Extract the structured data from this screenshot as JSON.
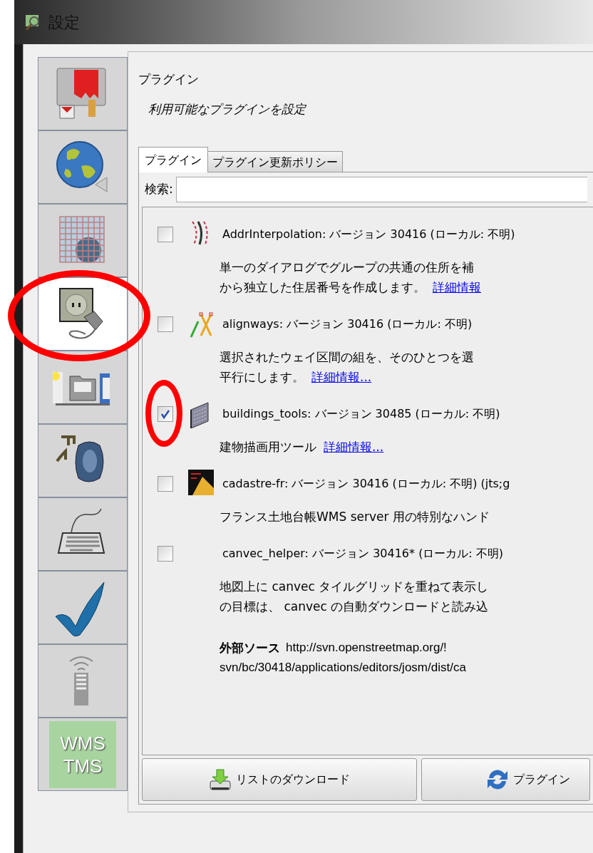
{
  "window": {
    "title": "設定"
  },
  "sidebar": {
    "items": [
      {
        "kind": "paint",
        "selected": false,
        "circled": false
      },
      {
        "kind": "globe",
        "selected": false,
        "circled": false
      },
      {
        "kind": "grid",
        "selected": false,
        "circled": false
      },
      {
        "kind": "plug",
        "selected": true,
        "circled": true
      },
      {
        "kind": "folders",
        "selected": false,
        "circled": false
      },
      {
        "kind": "speaker",
        "selected": false,
        "circled": false
      },
      {
        "kind": "keyboard",
        "selected": false,
        "circled": false
      },
      {
        "kind": "check",
        "selected": false,
        "circled": false
      },
      {
        "kind": "remote",
        "selected": false,
        "circled": false
      },
      {
        "kind": "wms",
        "selected": false,
        "circled": false,
        "label_lines": [
          "WMS",
          "TMS"
        ]
      }
    ]
  },
  "panel": {
    "title": "プラグイン",
    "subtitle": "利用可能なプラグインを設定"
  },
  "tabs": [
    {
      "label": "プラグイン",
      "selected": true
    },
    {
      "label": "プラグイン更新ポリシー",
      "selected": false
    }
  ],
  "search": {
    "label": "検索:"
  },
  "plugins": [
    {
      "kind": "addr",
      "checked": false,
      "circled": false,
      "title": "AddrInterpolation: バージョン 30416 (ローカル: 不明)",
      "description": [
        "単一のダイアログでグループの共通の住所を補",
        "から独立した住居番号を作成します。"
      ],
      "link": "詳細情報"
    },
    {
      "kind": "alignways",
      "checked": false,
      "circled": false,
      "title": "alignways: バージョン 30416 (ローカル: 不明)",
      "description": [
        "選択されたウェイ区間の組を、そのひとつを選",
        "平行にします。"
      ],
      "link": "詳細情報..."
    },
    {
      "kind": "buildings",
      "checked": true,
      "circled": true,
      "title": "buildings_tools: バージョン 30485 (ローカル: 不明)",
      "description": [
        "建物描画用ツール"
      ],
      "link": "詳細情報..."
    },
    {
      "kind": "cadastre",
      "checked": false,
      "circled": false,
      "title": "cadastre-fr: バージョン 30416 (ローカル: 不明) (jts;g",
      "description": [
        "フランス土地台帳WMS server 用の特別なハンド"
      ]
    },
    {
      "kind": "none",
      "checked": false,
      "circled": false,
      "title": "canvec_helper: バージョン 30416* (ローカル: 不明)",
      "description": [
        "地図上に canvec タイルグリッドを重ねて表示し",
        "の目標は、 canvec の自動ダウンロードと読み込"
      ],
      "source": {
        "label": "外部ソース",
        "url_lines": [
          "http://svn.openstreetmap.org/!",
          "svn/bc/30418/applications/editors/josm/dist/ca"
        ]
      }
    }
  ],
  "buttons": [
    {
      "kind": "download",
      "label": "リストのダウンロード"
    },
    {
      "kind": "refresh",
      "label": "プラグイン"
    }
  ]
}
